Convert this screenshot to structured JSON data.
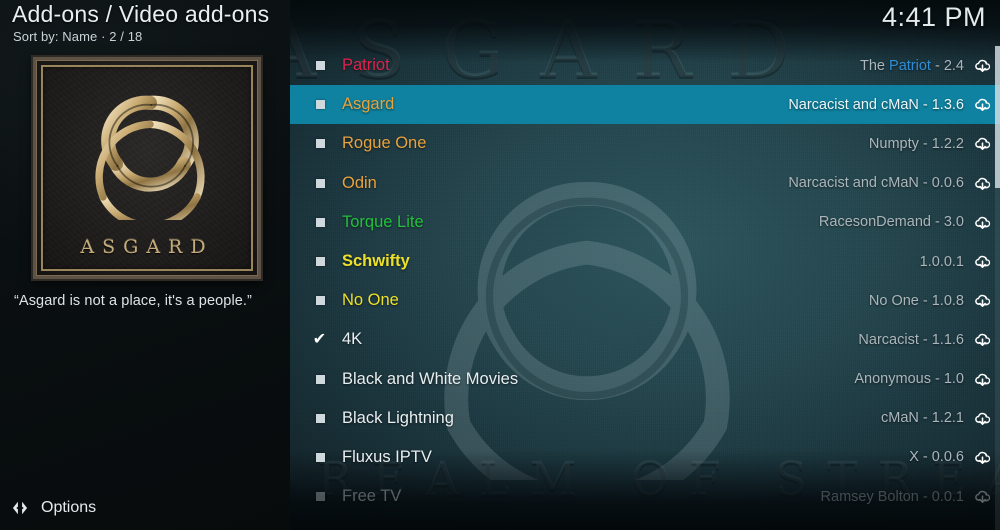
{
  "header": {
    "title": "Add-ons / Video add-ons",
    "subtitle": "Sort by: Name  ·  2 / 18",
    "clock": "4:41 PM"
  },
  "info_panel": {
    "poster_name": "ASGARD",
    "poster_symbol": "triple-horn-of-odin",
    "tagline": "“Asgard is not a place, it's a people.”"
  },
  "background": {
    "watermark_title": "ASGARD",
    "watermark_subtitle": "THE REALM OF STREAMING"
  },
  "footer": {
    "options_label": "Options",
    "options_icon": "options-arrows-icon"
  },
  "colors": {
    "selected_row": "#0e82a0",
    "label_red": "#e0224c",
    "label_orange": "#e8a33d",
    "label_green": "#22c03c",
    "label_yellow": "#ece02a",
    "label_white": "#e8eef0",
    "meta_gray": "#aab6bb",
    "meta_blue": "#2f8ed6"
  },
  "list": {
    "items": [
      {
        "name": "Patriot",
        "color": "#e0224c",
        "bold": false,
        "marker": "square",
        "meta_prefix": "The ",
        "meta_highlight": "Patriot",
        "meta_suffix": " - 2.4",
        "selected": false,
        "faded": false
      },
      {
        "name": "Asgard",
        "color": "#e8a33d",
        "bold": false,
        "marker": "square",
        "meta_prefix": "Narcacist and cMaN - 1.3.6",
        "meta_highlight": "",
        "meta_suffix": "",
        "selected": true,
        "faded": false
      },
      {
        "name": "Rogue One",
        "color": "#e8a33d",
        "bold": false,
        "marker": "square",
        "meta_prefix": "Numpty - 1.2.2",
        "meta_highlight": "",
        "meta_suffix": "",
        "selected": false,
        "faded": false
      },
      {
        "name": "Odin",
        "color": "#e8a33d",
        "bold": false,
        "marker": "square",
        "meta_prefix": "Narcacist and cMaN - 0.0.6",
        "meta_highlight": "",
        "meta_suffix": "",
        "selected": false,
        "faded": false
      },
      {
        "name": "Torque Lite",
        "color": "#22c03c",
        "bold": false,
        "marker": "square",
        "meta_prefix": "RacesonDemand - 3.0",
        "meta_highlight": "",
        "meta_suffix": "",
        "selected": false,
        "faded": false
      },
      {
        "name": "Schwifty",
        "color": "#ece02a",
        "bold": true,
        "marker": "square",
        "meta_prefix": "1.0.0.1",
        "meta_highlight": "",
        "meta_suffix": "",
        "selected": false,
        "faded": false
      },
      {
        "name": "No One",
        "color": "#ece02a",
        "bold": false,
        "marker": "square",
        "meta_prefix": "No One - 1.0.8",
        "meta_highlight": "",
        "meta_suffix": "",
        "selected": false,
        "faded": false
      },
      {
        "name": "4K",
        "color": "#e8eef0",
        "bold": false,
        "marker": "check",
        "meta_prefix": "Narcacist - 1.1.6",
        "meta_highlight": "",
        "meta_suffix": "",
        "selected": false,
        "faded": false
      },
      {
        "name": "Black and White Movies",
        "color": "#e8eef0",
        "bold": false,
        "marker": "square",
        "meta_prefix": "Anonymous - 1.0",
        "meta_highlight": "",
        "meta_suffix": "",
        "selected": false,
        "faded": false
      },
      {
        "name": "Black Lightning",
        "color": "#e8eef0",
        "bold": false,
        "marker": "square",
        "meta_prefix": "cMaN - 1.2.1",
        "meta_highlight": "",
        "meta_suffix": "",
        "selected": false,
        "faded": false
      },
      {
        "name": "Fluxus IPTV",
        "color": "#e8eef0",
        "bold": false,
        "marker": "square",
        "meta_prefix": "X - 0.0.6",
        "meta_highlight": "",
        "meta_suffix": "",
        "selected": false,
        "faded": false
      },
      {
        "name": "Free TV",
        "color": "#e8eef0",
        "bold": false,
        "marker": "square",
        "meta_prefix": "Ramsey Bolton - 0.0.1",
        "meta_highlight": "",
        "meta_suffix": "",
        "selected": false,
        "faded": true
      }
    ],
    "row_icon": "cloud-download-icon"
  }
}
